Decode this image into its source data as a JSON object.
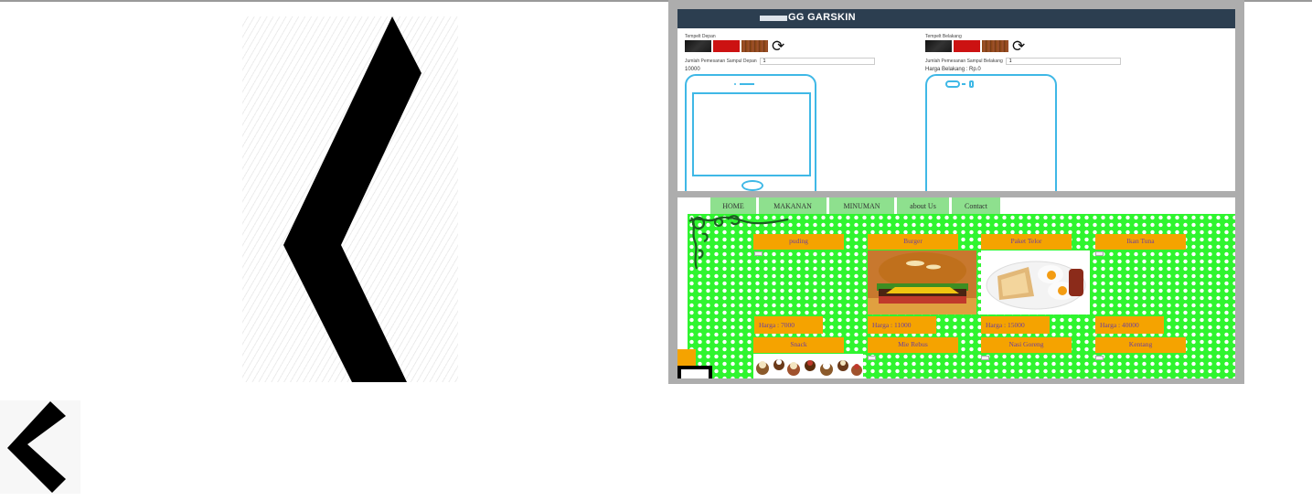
{
  "garskin": {
    "title": "GG GARSKIN",
    "front": {
      "label": "Tempelt Depan",
      "qty_label": "Jumlah Pemesanan Sampul Depan",
      "qty_value": "1",
      "price": "10000"
    },
    "back": {
      "label": "Tempelt Belakang",
      "qty_label": "Jumlah Pemesanan Sampul Belakang",
      "qty_value": "1",
      "price": "Harga Belakang : Rp.0"
    },
    "swatch_colors": [
      "black",
      "red",
      "wood"
    ],
    "refresh_icon": "⟳",
    "accent": "#3fb8e6",
    "header_color": "#2c3e50"
  },
  "food_site": {
    "nav": [
      "HOME",
      "MAKANAN",
      "MINUMAN",
      "about Us",
      "Contact"
    ],
    "row1": [
      "puding",
      "Burger",
      "Paket Telor",
      "Ikan Tuna"
    ],
    "prices": [
      "Harga : 7000",
      "Harga : 11000",
      "Harga : 15000",
      "Harga : 40000"
    ],
    "row2": [
      "Snack",
      "Mie Rebus",
      "Nasi Goreng",
      "Kentang"
    ],
    "colors": {
      "background": "#2ff52f",
      "title_bg": "#f5a300",
      "title_text": "#6b3fa0",
      "nav_bg": "#8ee08e"
    }
  }
}
